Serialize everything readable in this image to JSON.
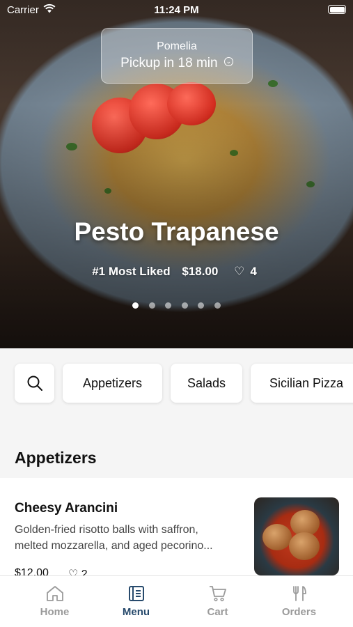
{
  "status_bar": {
    "carrier": "Carrier",
    "time": "11:24 PM"
  },
  "pickup": {
    "store": "Pomelia",
    "eta": "Pickup in 18 min"
  },
  "hero": {
    "title": "Pesto Trapanese",
    "rank": "#1 Most Liked",
    "price": "$18.00",
    "likes": "4",
    "page_count": 6,
    "active_page": 1
  },
  "categories": [
    "Appetizers",
    "Salads",
    "Sicilian Pizza"
  ],
  "section": {
    "title": "Appetizers"
  },
  "items": [
    {
      "name": "Cheesy Arancini",
      "description_line1": "Golden-fried risotto balls with saffron,",
      "description_line2": "melted mozzarella, and aged pecorino...",
      "price": "$12.00",
      "likes": "2"
    }
  ],
  "tabs": [
    {
      "label": "Home",
      "icon": "home-icon",
      "active": false
    },
    {
      "label": "Menu",
      "icon": "menu-book-icon",
      "active": true
    },
    {
      "label": "Cart",
      "icon": "cart-icon",
      "active": false
    },
    {
      "label": "Orders",
      "icon": "utensils-icon",
      "active": false
    }
  ],
  "colors": {
    "accent": "#274a6c",
    "inactive_tab": "#9a9a9a",
    "background": "#f5f5f5"
  }
}
